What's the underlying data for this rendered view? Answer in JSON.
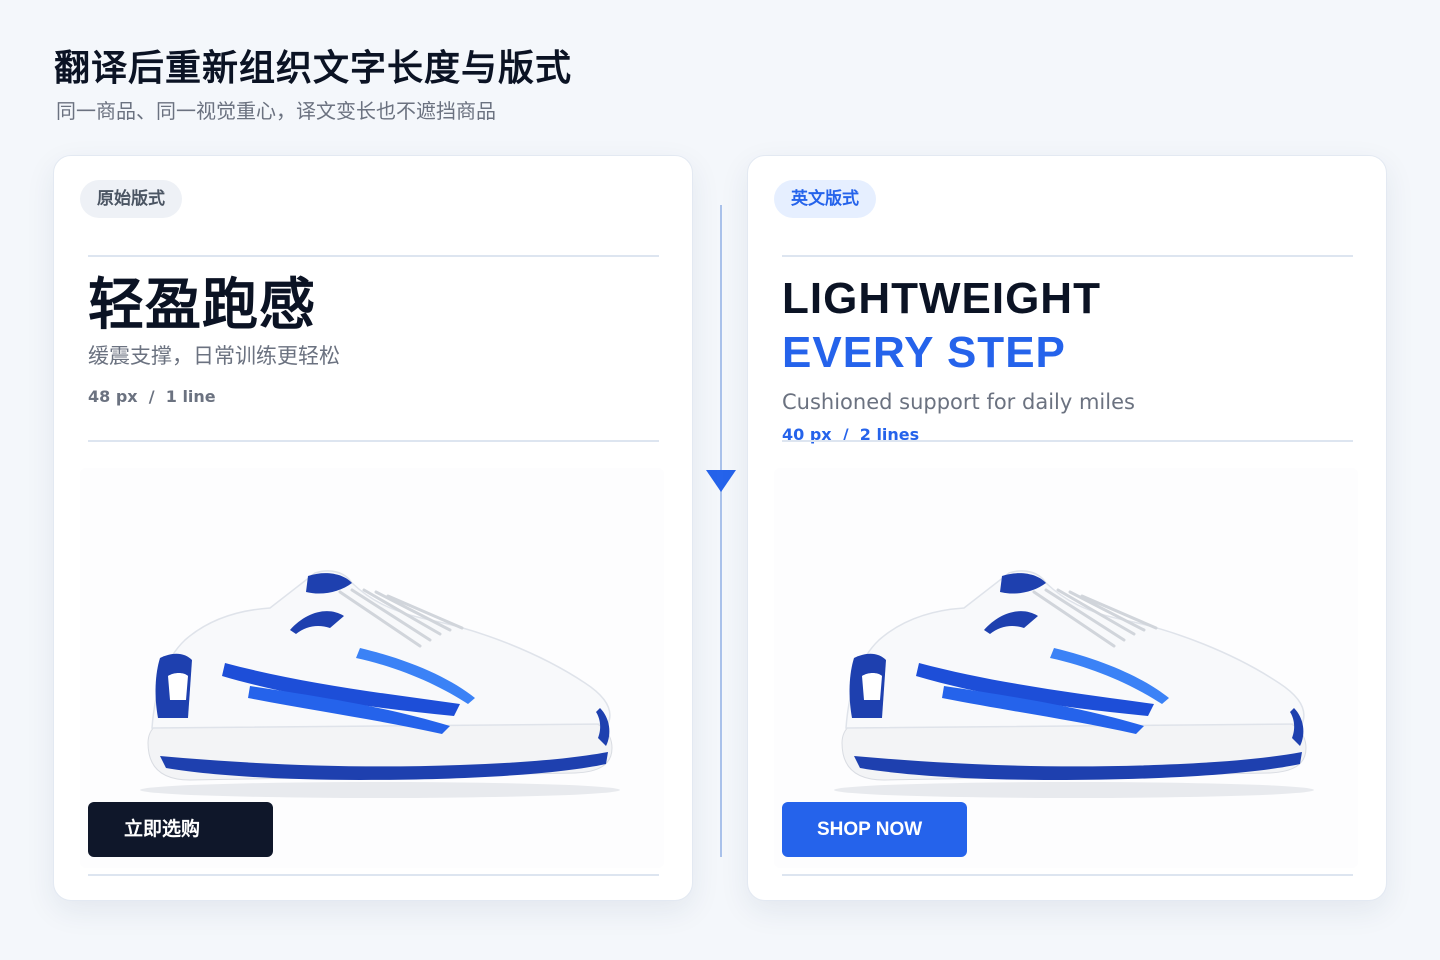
{
  "header": {
    "title": "翻译后重新组织文字长度与版式",
    "subtitle": "同一商品、同一视觉重心，译文变长也不遮挡商品"
  },
  "left_card": {
    "badge": "原始版式",
    "headline": "轻盈跑感",
    "subline": "缓震支撑，日常训练更轻松",
    "meta": "48 px  /  1 line",
    "cta": "立即选购",
    "product_alt": "white-blue running shoe"
  },
  "right_card": {
    "badge": "英文版式",
    "headline_line1": "LIGHTWEIGHT",
    "headline_line2": "EVERY STEP",
    "subline": "Cushioned support for daily miles",
    "meta": "40 px  /  2 lines",
    "cta": "SHOP NOW",
    "product_alt": "white-blue running shoe"
  },
  "colors": {
    "accent": "#2563eb",
    "dark": "#0f172a",
    "muted": "#6b7280",
    "background": "#f4f7fb"
  },
  "icons": {
    "connector": "down-arrow-icon"
  }
}
